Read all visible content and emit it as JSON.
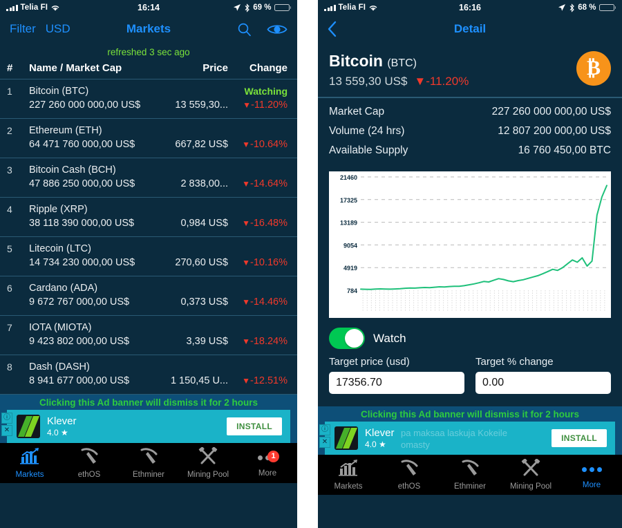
{
  "left": {
    "status": {
      "carrier": "Telia FI",
      "wifi_icon": "wifi-icon",
      "time": "16:14",
      "battery": "69 %",
      "location_icon": "location-arrow-icon",
      "bluetooth_icon": "bluetooth-icon"
    },
    "nav": {
      "filter": "Filter",
      "currency": "USD",
      "title": "Markets",
      "search_icon": "search-icon",
      "watch_icon": "eye-icon"
    },
    "refreshed": "refreshed 3 sec ago",
    "columns": {
      "num": "#",
      "name": "Name / Market Cap",
      "price": "Price",
      "change": "Change"
    },
    "rows": [
      {
        "num": "1",
        "name": "Bitcoin (BTC)",
        "cap": "227 260 000 000,00 US$",
        "price": "13 559,30...",
        "change": "-11.20%",
        "status": "Watching"
      },
      {
        "num": "2",
        "name": "Ethereum (ETH)",
        "cap": "64 471 760 000,00 US$",
        "price": "667,82 US$",
        "change": "-10.64%",
        "status": ""
      },
      {
        "num": "3",
        "name": "Bitcoin Cash (BCH)",
        "cap": "47 886 250 000,00 US$",
        "price": "2 838,00...",
        "change": "-14.64%",
        "status": ""
      },
      {
        "num": "4",
        "name": "Ripple (XRP)",
        "cap": "38 118 390 000,00 US$",
        "price": "0,984 US$",
        "change": "-16.48%",
        "status": ""
      },
      {
        "num": "5",
        "name": "Litecoin (LTC)",
        "cap": "14 734 230 000,00 US$",
        "price": "270,60 US$",
        "change": "-10.16%",
        "status": ""
      },
      {
        "num": "6",
        "name": "Cardano (ADA)",
        "cap": "9 672 767 000,00 US$",
        "price": "0,373 US$",
        "change": "-14.46%",
        "status": ""
      },
      {
        "num": "7",
        "name": "IOTA (MIOTA)",
        "cap": "9 423 802 000,00 US$",
        "price": "3,39 US$",
        "change": "-18.24%",
        "status": ""
      },
      {
        "num": "8",
        "name": "Dash (DASH)",
        "cap": "8 941 677 000,00 US$",
        "price": "1 150,45 U...",
        "change": "-12.51%",
        "status": ""
      }
    ],
    "ad": {
      "note": "Clicking this Ad banner will dismiss it for 2 hours",
      "title": "Klever",
      "rating": "4.0",
      "star": "★",
      "install": "INSTALL",
      "ghost_line1": "",
      "ghost_line2": "",
      "info_badge": "ⓘ",
      "close_badge": "✕"
    },
    "tabs": [
      {
        "label": "Markets",
        "icon": "chart-bars-icon",
        "active": true,
        "badge": ""
      },
      {
        "label": "ethOS",
        "icon": "pickaxe-icon",
        "active": false,
        "badge": ""
      },
      {
        "label": "Ethminer",
        "icon": "pickaxe-icon",
        "active": false,
        "badge": ""
      },
      {
        "label": "Mining Pool",
        "icon": "crossed-hammers-icon",
        "active": false,
        "badge": ""
      },
      {
        "label": "More",
        "icon": "ellipsis-icon",
        "active": false,
        "badge": "1"
      }
    ]
  },
  "right": {
    "status": {
      "carrier": "Telia FI",
      "wifi_icon": "wifi-icon",
      "time": "16:16",
      "battery": "68 %",
      "location_icon": "location-arrow-icon",
      "bluetooth_icon": "bluetooth-icon"
    },
    "nav": {
      "back_icon": "chevron-left-icon",
      "title": "Detail"
    },
    "coin": {
      "name": "Bitcoin",
      "symbol": "(BTC)",
      "price": "13 559,30 US$",
      "change": "-11.20%",
      "logo": "bitcoin-logo",
      "logo_glyph": "₿",
      "logo_color": "#f7931a"
    },
    "stats": [
      {
        "key": "Market Cap",
        "value": "227 260 000 000,00 US$"
      },
      {
        "key": "Volume (24 hrs)",
        "value": "12 807 200 000,00 US$"
      },
      {
        "key": "Available Supply",
        "value": "16 760 450,00 BTC"
      }
    ],
    "watch": {
      "label": "Watch",
      "on": true
    },
    "target_price": {
      "label": "Target price (usd)",
      "value": "17356.70"
    },
    "target_change": {
      "label": "Target % change",
      "value": "0.00"
    },
    "ad": {
      "note": "Clicking this Ad banner will dismiss it for 2 hours",
      "title": "Klever",
      "rating": "4.0",
      "star": "★",
      "install": "INSTALL",
      "ghost_line1": "pa maksaa laskuja Kokeile",
      "ghost_line2": "omasty",
      "info_badge": "ⓘ",
      "close_badge": "✕"
    },
    "tabs": [
      {
        "label": "Markets",
        "icon": "chart-bars-icon",
        "active": false,
        "badge": ""
      },
      {
        "label": "ethOS",
        "icon": "pickaxe-icon",
        "active": false,
        "badge": ""
      },
      {
        "label": "Ethminer",
        "icon": "pickaxe-icon",
        "active": false,
        "badge": ""
      },
      {
        "label": "Mining Pool",
        "icon": "crossed-hammers-icon",
        "active": false,
        "badge": ""
      },
      {
        "label": "More",
        "icon": "ellipsis-icon",
        "active": true,
        "badge": ""
      }
    ]
  },
  "chart_data": {
    "type": "line",
    "title": "",
    "xlabel": "",
    "ylabel": "",
    "line_color": "#1ec07a",
    "grid": true,
    "ylim": [
      784,
      21460
    ],
    "yticks": [
      784,
      4919,
      9054,
      13189,
      17325,
      21460
    ],
    "ytick_labels": [
      "784",
      "4919",
      "9054",
      "13189",
      "17325",
      "21460"
    ],
    "x": [
      0,
      2,
      4,
      6,
      8,
      10,
      12,
      14,
      16,
      18,
      20,
      22,
      24,
      26,
      28,
      30,
      32,
      34,
      36,
      38,
      40,
      42,
      44,
      46,
      48,
      50,
      52,
      54,
      56,
      58,
      60,
      62,
      64,
      66,
      68,
      70,
      72,
      74,
      76,
      78,
      80,
      82,
      84,
      86,
      88,
      90,
      92,
      94,
      96,
      98,
      100
    ],
    "values": [
      980,
      960,
      940,
      1000,
      1040,
      1010,
      990,
      1020,
      1080,
      1150,
      1200,
      1180,
      1240,
      1290,
      1260,
      1340,
      1420,
      1390,
      1470,
      1520,
      1500,
      1620,
      1780,
      1950,
      2150,
      2380,
      2300,
      2600,
      2900,
      2750,
      2500,
      2350,
      2550,
      2700,
      2950,
      3200,
      3450,
      3800,
      4200,
      4600,
      4400,
      4900,
      5600,
      6300,
      5900,
      6700,
      5200,
      6100,
      14500,
      17800,
      19900
    ]
  }
}
